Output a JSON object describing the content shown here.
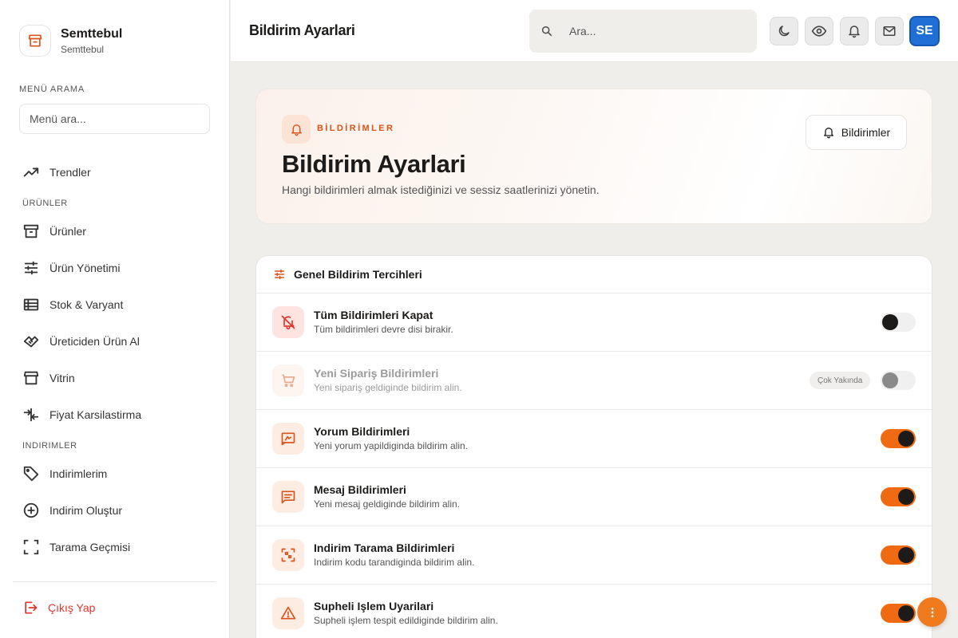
{
  "colors": {
    "accent": "#f06a12",
    "brand_blue": "#1f6fd6",
    "danger": "#e0352b"
  },
  "sidebar": {
    "brand_name": "Semttebul",
    "brand_sub": "Semttebul",
    "menu_search_label": "MENÜ ARAMA",
    "menu_search_placeholder": "Menü ara...",
    "trends": "Trendler",
    "section_products": "ÜRÜNLER",
    "products": "Ürünler",
    "product_management": "Ürün Yönetimi",
    "stock_variant": "Stok & Varyant",
    "buy_from_manufacturer": "Üreticiden Ürün Al",
    "showcase": "Vitrin",
    "price_compare": "Fiyat Karsilastirma",
    "section_discounts": "INDIRIMLER",
    "my_discounts": "Indirimlerim",
    "create_discount": "Indirim Oluştur",
    "scan_history": "Tarama Geçmisi",
    "logout": "Çıkış Yap"
  },
  "header": {
    "title": "Bildirim Ayarlari",
    "search_placeholder": "Ara...",
    "avatar_initials": "SE"
  },
  "hero": {
    "eyebrow": "BİLDİRİMLER",
    "title": "Bildirim Ayarlari",
    "description": "Hangi bildirimleri almak istediğinizi ve sessiz saatlerinizi yönetin.",
    "button": "Bildirimler"
  },
  "prefs": {
    "title": "Genel Bildirim Tercihleri",
    "rows": [
      {
        "title": "Tüm Bildirimleri Kapat",
        "desc": "Tüm bildirimleri devre disi birakir.",
        "on": false,
        "icon": "bell-off-icon"
      },
      {
        "title": "Yeni Sipariş Bildirimleri",
        "desc": "Yeni sipariş geldiginde bildirim alin.",
        "on": false,
        "disabled": true,
        "badge": "Çok Yakında",
        "icon": "cart-icon"
      },
      {
        "title": "Yorum Bildirimleri",
        "desc": "Yeni yorum yapildiginda bildirim alin.",
        "on": true,
        "icon": "review-icon"
      },
      {
        "title": "Mesaj Bildirimleri",
        "desc": "Yeni mesaj geldiginde bildirim alin.",
        "on": true,
        "icon": "message-icon"
      },
      {
        "title": "Indirim Tarama Bildirimleri",
        "desc": "Indirim kodu tarandiginda bildirim alin.",
        "on": true,
        "icon": "qr-scan-icon"
      },
      {
        "title": "Supheli Işlem Uyarilari",
        "desc": "Supheli işlem tespit edildiginde bildirim alin.",
        "on": true,
        "icon": "warning-icon"
      }
    ]
  }
}
